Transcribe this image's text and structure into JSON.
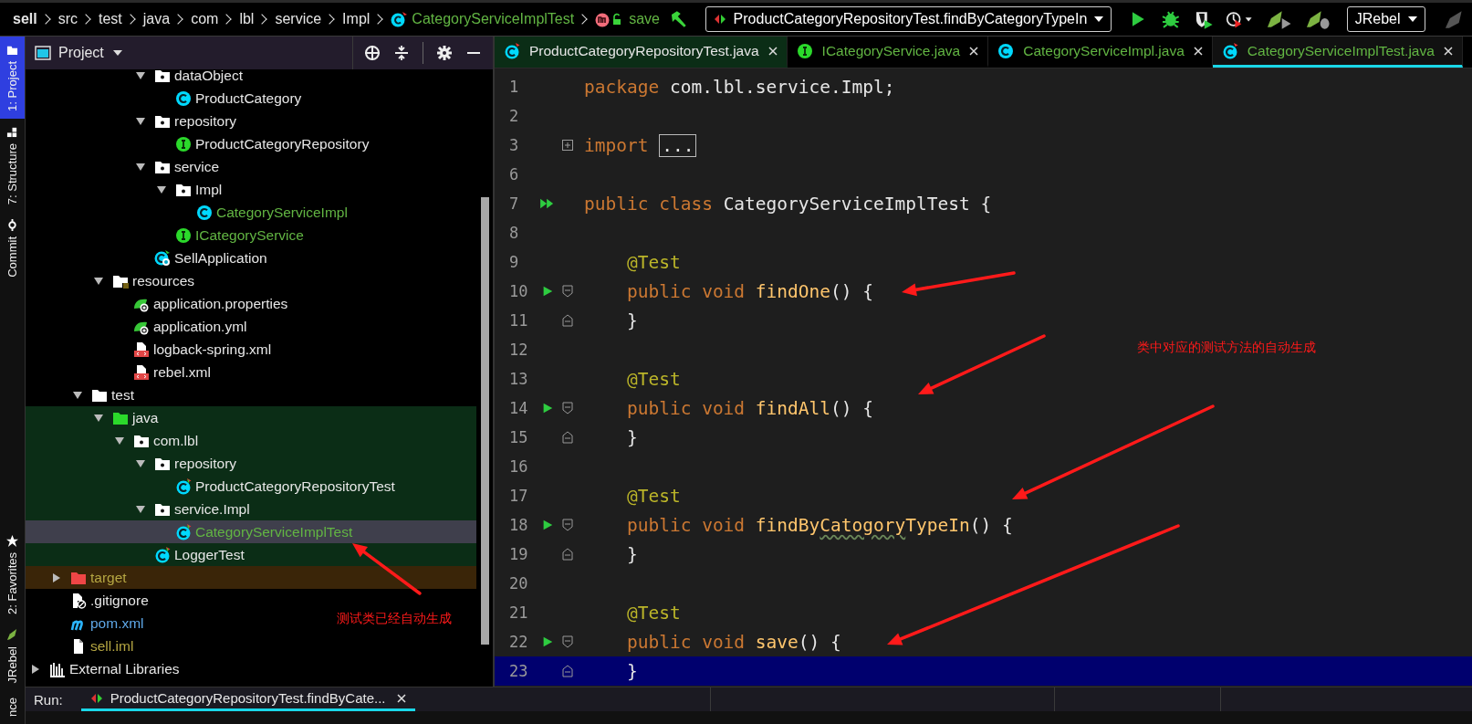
{
  "breadcrumb": [
    {
      "label": "sell",
      "kind": "project"
    },
    {
      "label": "src",
      "kind": "folder"
    },
    {
      "label": "test",
      "kind": "folder"
    },
    {
      "label": "java",
      "kind": "folder"
    },
    {
      "label": "com",
      "kind": "folder"
    },
    {
      "label": "lbl",
      "kind": "folder"
    },
    {
      "label": "service",
      "kind": "folder"
    },
    {
      "label": "Impl",
      "kind": "folder"
    },
    {
      "label": "CategoryServiceImplTest",
      "kind": "test-class"
    },
    {
      "label": "save",
      "kind": "method"
    }
  ],
  "run_config": {
    "label": "ProductCategoryRepositoryTest.findByCategoryTypeIn"
  },
  "jrebel_select": {
    "label": "JRebel"
  },
  "tool_stripe": [
    {
      "label": "1: Project",
      "kind": "project",
      "selected": true
    },
    {
      "label": "7: Structure",
      "kind": "structure",
      "selected": false
    },
    {
      "label": "Commit",
      "kind": "commit",
      "selected": false
    },
    {
      "label": "2: Favorites",
      "kind": "favorites",
      "selected": false
    },
    {
      "label": "JRebel",
      "kind": "jrebel",
      "selected": false
    },
    {
      "label": "nce",
      "kind": "plain",
      "selected": false
    }
  ],
  "project_panel": {
    "title": "Project",
    "tree": [
      {
        "children": [
          {
            "children": [
              {
                "children": [
                  {
                    "children": [
                      {
                        "children": [
                          {
                            "label": "dataObject",
                            "kind": "package",
                            "expanded": true,
                            "color": "#e6e6e6",
                            "selected": false,
                            "children": [
                              {
                                "label": "ProductCategory",
                                "kind": "class",
                                "color": "#e6e6e6",
                                "selected": false
                              }
                            ]
                          },
                          {
                            "label": "repository",
                            "kind": "package",
                            "expanded": true,
                            "color": "#e6e6e6",
                            "selected": false,
                            "children": [
                              {
                                "label": "ProductCategoryRepository",
                                "kind": "interface",
                                "color": "#e6e6e6",
                                "selected": false
                              }
                            ]
                          },
                          {
                            "label": "service",
                            "kind": "package",
                            "expanded": true,
                            "color": "#e6e6e6",
                            "selected": false,
                            "children": [
                              {
                                "label": "Impl",
                                "kind": "package",
                                "expanded": true,
                                "color": "#e6e6e6",
                                "selected": false,
                                "children": [
                                  {
                                    "label": "CategoryServiceImpl",
                                    "kind": "class",
                                    "color": "#62b543",
                                    "selected": false
                                  }
                                ]
                              },
                              {
                                "label": "ICategoryService",
                                "kind": "interface",
                                "color": "#62b543",
                                "selected": false
                              }
                            ]
                          },
                          {
                            "label": "SellApplication",
                            "kind": "spring-class",
                            "color": "#e6e6e6",
                            "selected": false
                          }
                        ]
                      }
                    ]
                  },
                  {
                    "label": "resources",
                    "kind": "resources",
                    "expanded": true,
                    "color": "#e6e6e6",
                    "selected": false,
                    "children": [
                      {
                        "label": "application.properties",
                        "kind": "spring-config",
                        "color": "#e6e6e6",
                        "selected": false
                      },
                      {
                        "label": "application.yml",
                        "kind": "spring-config",
                        "color": "#e6e6e6",
                        "selected": false
                      },
                      {
                        "label": "logback-spring.xml",
                        "kind": "xml",
                        "color": "#e6e6e6",
                        "selected": false
                      },
                      {
                        "label": "rebel.xml",
                        "kind": "xml",
                        "color": "#e6e6e6",
                        "selected": false
                      }
                    ]
                  }
                ]
              },
              {
                "label": "test",
                "kind": "folder",
                "expanded": true,
                "color": "#e6e6e6",
                "selected": false,
                "children": [
                  {
                    "label": "java",
                    "kind": "test-root",
                    "expanded": true,
                    "color": "#e6e6e6",
                    "selected": false,
                    "children": [
                      {
                        "label": "com.lbl",
                        "kind": "package",
                        "expanded": true,
                        "color": "#e6e6e6",
                        "selected": false,
                        "children": [
                          {
                            "label": "repository",
                            "kind": "package",
                            "expanded": true,
                            "color": "#e6e6e6",
                            "selected": false,
                            "children": [
                              {
                                "label": "ProductCategoryRepositoryTest",
                                "kind": "test-class",
                                "color": "#e6e6e6",
                                "selected": false
                              }
                            ]
                          },
                          {
                            "label": "service.Impl",
                            "kind": "package",
                            "expanded": true,
                            "color": "#e6e6e6",
                            "selected": false,
                            "children": [
                              {
                                "label": "CategoryServiceImplTest",
                                "kind": "test-class",
                                "color": "#62b543",
                                "selected": true
                              }
                            ]
                          },
                          {
                            "label": "LoggerTest",
                            "kind": "test-class",
                            "color": "#e6e6e6",
                            "selected": false
                          }
                        ]
                      }
                    ]
                  }
                ]
              }
            ]
          },
          {
            "label": "target",
            "kind": "excluded",
            "expanded": false,
            "color": "#b5a642",
            "selected": false
          },
          {
            "label": ".gitignore",
            "kind": "ignore-file",
            "color": "#e6e6e6",
            "selected": false
          },
          {
            "label": "pom.xml",
            "kind": "maven",
            "color": "#5fa8e8",
            "selected": false
          },
          {
            "label": "sell.iml",
            "kind": "file",
            "color": "#b5a642",
            "selected": false
          }
        ]
      },
      {
        "label": "External Libraries",
        "kind": "libraries",
        "expanded": false,
        "color": "#e6e6e6",
        "selected": false
      }
    ]
  },
  "editor_tabs": [
    {
      "label": "ProductCategoryRepositoryTest.java",
      "kind": "test-class",
      "color": "#e6e6e6",
      "selected": false
    },
    {
      "label": "ICategoryService.java",
      "kind": "interface",
      "color": "#62b543",
      "selected": false
    },
    {
      "label": "CategoryServiceImpl.java",
      "kind": "class",
      "color": "#62b543",
      "selected": false
    },
    {
      "label": "CategoryServiceImplTest.java",
      "kind": "test-class",
      "color": "#62b543",
      "selected": true
    }
  ],
  "code_lines": [
    {
      "number": "1",
      "kind": "code",
      "current": false,
      "tokens": [
        {
          "text": "package",
          "kind": "keyword"
        },
        {
          "text": " com.lbl.service.Impl;",
          "kind": "plain"
        }
      ]
    },
    {
      "number": "2",
      "kind": "code",
      "current": false
    },
    {
      "number": "3",
      "kind": "import",
      "current": false,
      "tokens": [
        {
          "text": "import ",
          "kind": "keyword"
        },
        {
          "text": "...",
          "kind": "folded"
        }
      ]
    },
    {
      "number": "6",
      "kind": "code",
      "current": false
    },
    {
      "number": "7",
      "kind": "class-header",
      "current": false,
      "tokens": [
        {
          "text": "public class",
          "kind": "keyword"
        },
        {
          "text": " CategoryServiceImplTest {",
          "kind": "plain"
        }
      ]
    },
    {
      "number": "8",
      "kind": "code",
      "current": false
    },
    {
      "number": "9",
      "kind": "code",
      "current": false,
      "tokens": [
        {
          "text": "    @Test",
          "kind": "annotation"
        }
      ]
    },
    {
      "number": "10",
      "kind": "test-method",
      "current": false,
      "tokens": [
        {
          "text": "    public void ",
          "kind": "keyword"
        },
        {
          "text": "findOne",
          "kind": "method"
        },
        {
          "text": "() {",
          "kind": "plain"
        }
      ]
    },
    {
      "number": "11",
      "kind": "block-end",
      "current": false,
      "tokens": [
        {
          "text": "    }",
          "kind": "plain"
        }
      ]
    },
    {
      "number": "12",
      "kind": "code",
      "current": false
    },
    {
      "number": "13",
      "kind": "code",
      "current": false,
      "tokens": [
        {
          "text": "    @Test",
          "kind": "annotation"
        }
      ]
    },
    {
      "number": "14",
      "kind": "test-method",
      "current": false,
      "tokens": [
        {
          "text": "    public void ",
          "kind": "keyword"
        },
        {
          "text": "findAll",
          "kind": "method"
        },
        {
          "text": "() {",
          "kind": "plain"
        }
      ]
    },
    {
      "number": "15",
      "kind": "block-end",
      "current": false,
      "tokens": [
        {
          "text": "    }",
          "kind": "plain"
        }
      ]
    },
    {
      "number": "16",
      "kind": "code",
      "current": false
    },
    {
      "number": "17",
      "kind": "code",
      "current": false,
      "tokens": [
        {
          "text": "    @Test",
          "kind": "annotation"
        }
      ]
    },
    {
      "number": "18",
      "kind": "test-method",
      "current": false,
      "tokens": [
        {
          "text": "    public void ",
          "kind": "keyword"
        },
        {
          "text": "findBy",
          "kind": "method"
        },
        {
          "text": "Catogory",
          "kind": "method-typo"
        },
        {
          "text": "TypeIn",
          "kind": "method"
        },
        {
          "text": "() {",
          "kind": "plain"
        }
      ]
    },
    {
      "number": "19",
      "kind": "block-end",
      "current": false,
      "tokens": [
        {
          "text": "    }",
          "kind": "plain"
        }
      ]
    },
    {
      "number": "20",
      "kind": "code",
      "current": false
    },
    {
      "number": "21",
      "kind": "code",
      "current": false,
      "tokens": [
        {
          "text": "    @Test",
          "kind": "annotation"
        }
      ]
    },
    {
      "number": "22",
      "kind": "test-method",
      "current": false,
      "tokens": [
        {
          "text": "    public void ",
          "kind": "keyword"
        },
        {
          "text": "save",
          "kind": "method"
        },
        {
          "text": "() {",
          "kind": "plain"
        }
      ]
    },
    {
      "number": "23",
      "kind": "block-end",
      "current": true,
      "tokens": [
        {
          "text": "    }",
          "kind": "plain"
        }
      ]
    }
  ],
  "annotations": [
    {
      "text": "类中对应的测试方法的自动生成"
    },
    {
      "text": "测试类已经自动生成"
    }
  ],
  "run_bar": {
    "label": "Run:",
    "tab": {
      "label": "ProductCategoryRepositoryTest.findByCate...",
      "selected": true
    }
  }
}
